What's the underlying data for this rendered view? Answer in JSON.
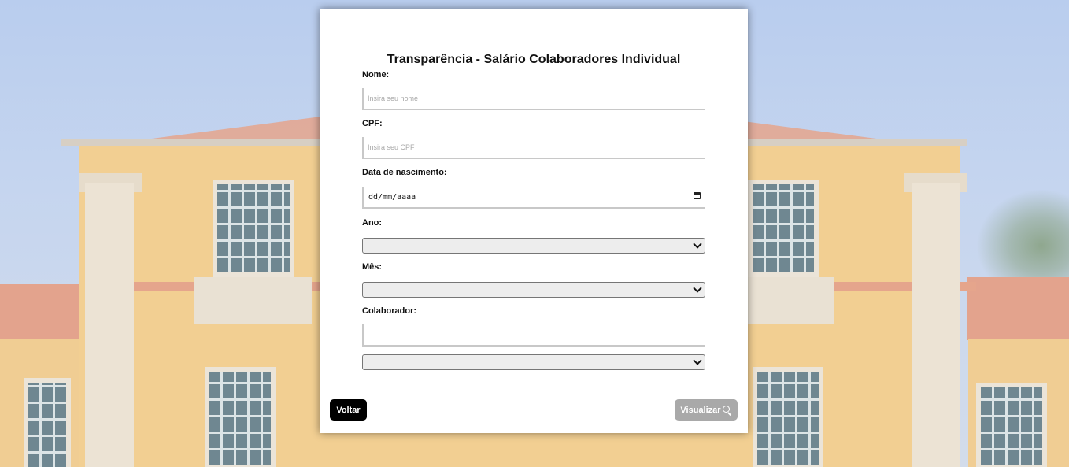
{
  "form": {
    "title": "Transparência - Salário Colaboradores Individual",
    "nome": {
      "label": "Nome:",
      "placeholder": "Insira seu nome",
      "value": ""
    },
    "cpf": {
      "label": "CPF:",
      "placeholder": "Insira seu CPF",
      "value": ""
    },
    "nascimento": {
      "label": "Data de nascimento:",
      "value": "dd/mm/aaaa",
      "icon": "calendar-icon"
    },
    "ano": {
      "label": "Ano:",
      "selected": ""
    },
    "mes": {
      "label": "Mês:",
      "selected": ""
    },
    "colaborador": {
      "label": "Colaborador:",
      "value": "",
      "selected": ""
    }
  },
  "actions": {
    "back_label": "Voltar",
    "view_label": "Visualizar",
    "view_icon": "search-icon",
    "back_color": "#000000",
    "view_color": "#a9a9a9"
  }
}
